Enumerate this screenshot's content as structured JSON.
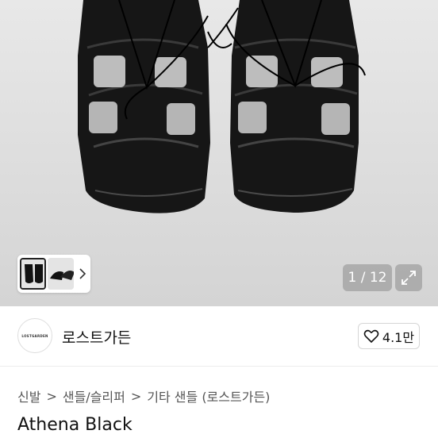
{
  "gallery": {
    "counter": "1 / 12",
    "thumbs_arrow": "›"
  },
  "shop": {
    "logo_text": "LOSTGARDEN",
    "name": "로스트가든",
    "likes": "4.1만"
  },
  "breadcrumb": {
    "items": [
      "신발",
      "샌들/슬리퍼",
      "기타 샌들 (로스트가든)"
    ],
    "separator": ">"
  },
  "product": {
    "title": "Athena Black"
  }
}
